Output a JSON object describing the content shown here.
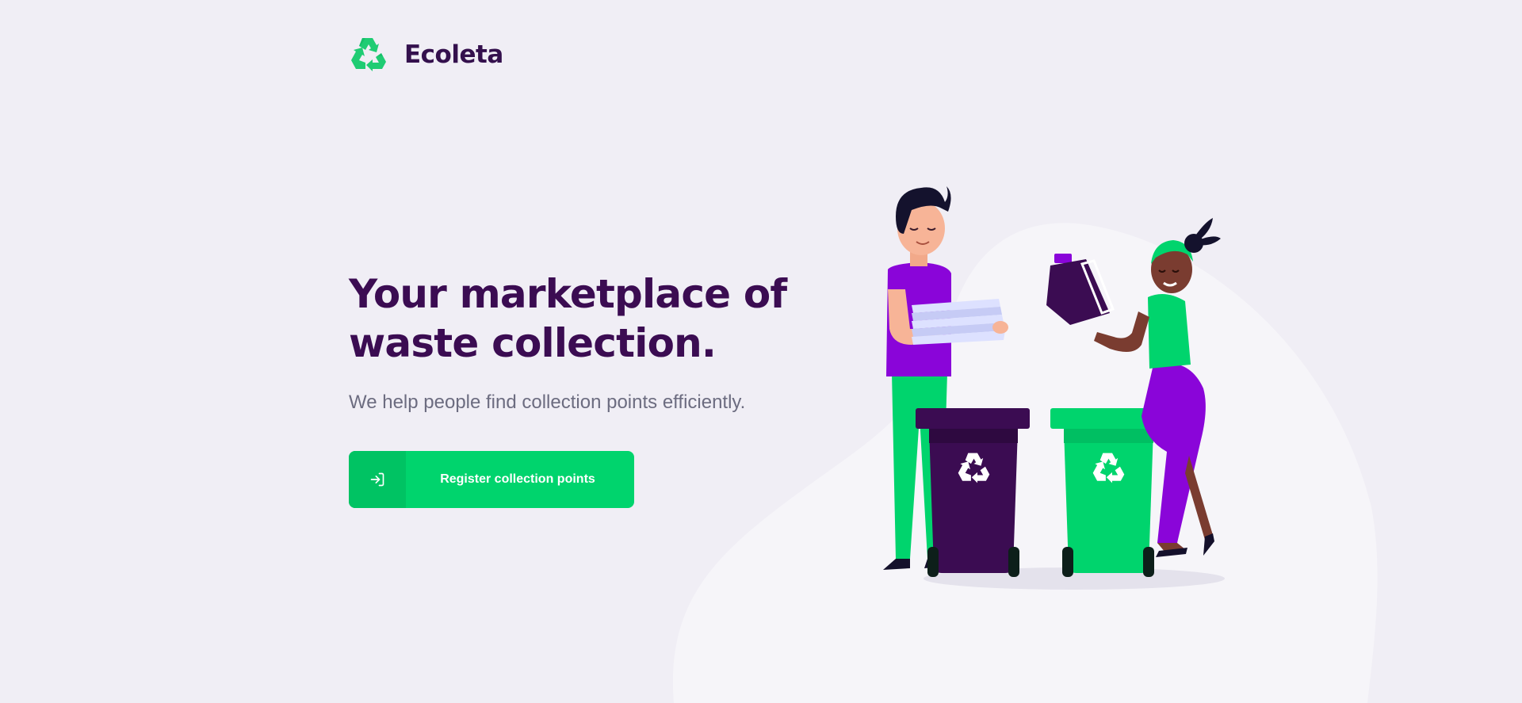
{
  "header": {
    "brand_name": "Ecoleta",
    "logo_icon": "recycle-icon"
  },
  "hero": {
    "title": "Your marketplace of waste collection.",
    "subtitle": "We help people find collection points efficiently."
  },
  "cta": {
    "label": "Register collection points",
    "icon": "log-in-icon"
  },
  "colors": {
    "background": "#f0eef5",
    "brand_dark": "#34104d",
    "accent_green": "#00d46d",
    "accent_green_dark": "#00c363",
    "text_muted": "#6c6c80",
    "purple": "#8a05d9"
  }
}
